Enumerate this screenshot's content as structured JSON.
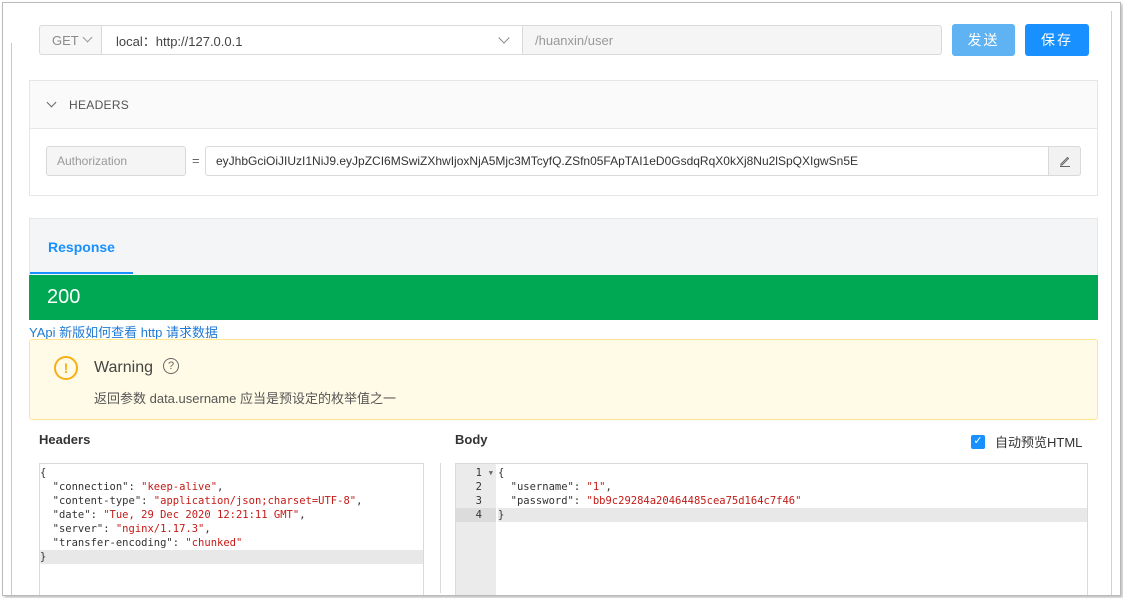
{
  "request": {
    "method": "GET",
    "env": "local：http://127.0.0.1",
    "path": "/huanxin/user",
    "send_label": "发送",
    "save_label": "保存"
  },
  "headers_panel": {
    "title": "HEADERS",
    "auth_key": "Authorization",
    "equals": "=",
    "auth_value": "eyJhbGciOiJIUzI1NiJ9.eyJpZCI6MSwiZXhwIjoxNjA5Mjc3MTcyfQ.ZSfn05FApTAI1eD0GsdqRqX0kXj8Nu2lSpQXIgwSn5E"
  },
  "response": {
    "tab_label": "Response",
    "status_code": "200",
    "help_link": "YApi 新版如何查看 http 请求数据",
    "warning": {
      "title": "Warning",
      "icon": "!",
      "help_icon": "?",
      "description": "返回参数 data.username 应当是预设定的枚举值之一"
    },
    "headers_title": "Headers",
    "body_title": "Body",
    "auto_preview_label": "自动预览HTML",
    "auto_preview_checked": true
  },
  "headers_code": [
    {
      "prefix": "{",
      "value": "",
      "suffix": ""
    },
    {
      "prefix": "  \"connection\": ",
      "value": "\"keep-alive\"",
      "suffix": ","
    },
    {
      "prefix": "  \"content-type\": ",
      "value": "\"application/json;charset=UTF-8\"",
      "suffix": ","
    },
    {
      "prefix": "  \"date\": ",
      "value": "\"Tue, 29 Dec 2020 12:21:11 GMT\"",
      "suffix": ","
    },
    {
      "prefix": "  \"server\": ",
      "value": "\"nginx/1.17.3\"",
      "suffix": ","
    },
    {
      "prefix": "  \"transfer-encoding\": ",
      "value": "\"chunked\"",
      "suffix": ""
    },
    {
      "prefix": "}",
      "value": "",
      "suffix": ""
    }
  ],
  "body_code": {
    "line_numbers": [
      "1",
      "2",
      "3",
      "4"
    ],
    "lines": [
      {
        "prefix": "{",
        "value": "",
        "suffix": ""
      },
      {
        "prefix": "  \"username\": ",
        "value": "\"1\"",
        "suffix": ","
      },
      {
        "prefix": "  \"password\": ",
        "value": "\"bb9c29284a20464485cea75d164c7f46\"",
        "suffix": ""
      },
      {
        "prefix": "}",
        "value": "",
        "suffix": ""
      }
    ]
  },
  "colors": {
    "accent": "#1890ff",
    "status_ok": "#00a854",
    "warning_bg": "#fffbe6",
    "warning_icon": "#faad14",
    "code_string": "#c41a16"
  }
}
